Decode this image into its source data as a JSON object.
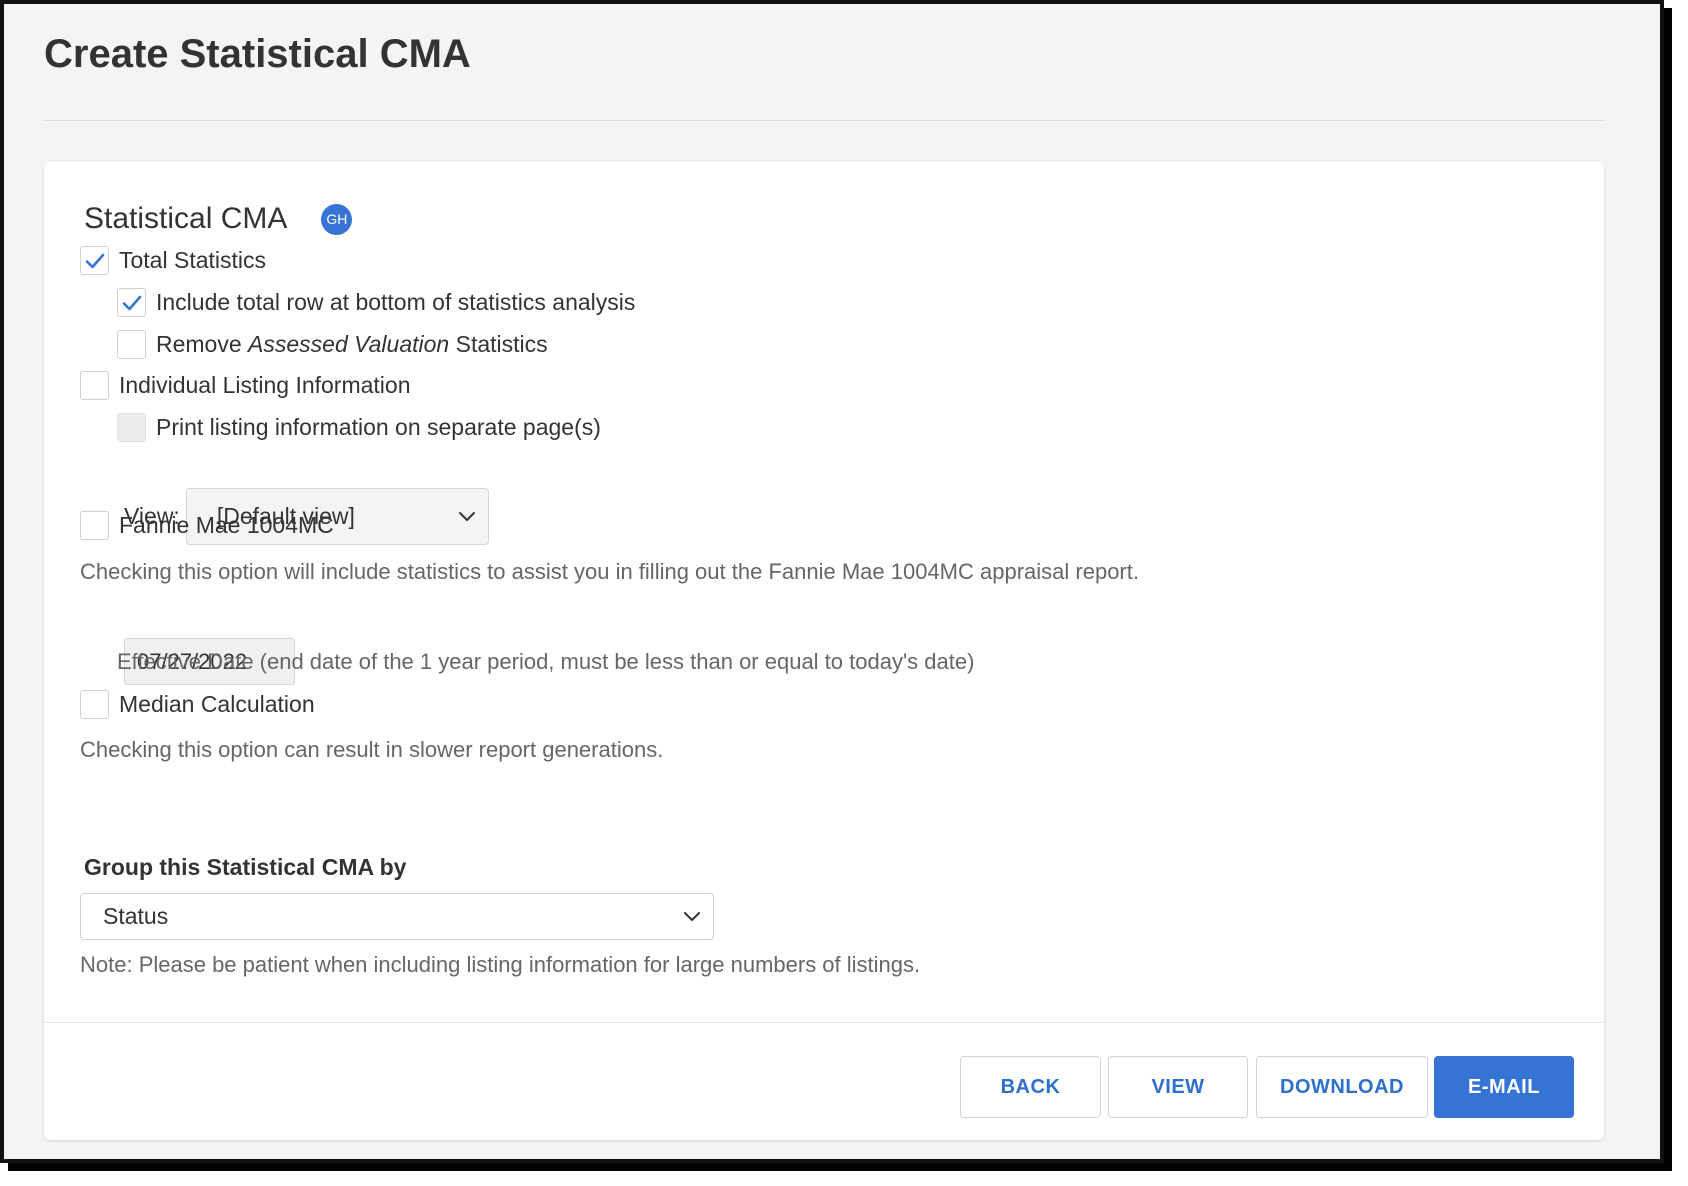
{
  "page": {
    "title": "Create Statistical CMA"
  },
  "card": {
    "title": "Statistical CMA",
    "avatar_initials": "GH"
  },
  "options": {
    "total_statistics": {
      "label": "Total Statistics",
      "checked": true
    },
    "include_total_row": {
      "label": "Include total row at bottom of statistics analysis",
      "checked": true
    },
    "remove_assessed": {
      "label_prefix": "Remove ",
      "label_italic": "Assessed Valuation",
      "label_suffix": " Statistics",
      "checked": false
    },
    "individual_listing": {
      "label": "Individual Listing Information",
      "checked": false
    },
    "print_separate": {
      "label": "Print listing information on separate page(s)",
      "checked": false,
      "disabled": true
    },
    "view": {
      "label": "View:",
      "selected": "[Default view]"
    },
    "fannie_mae": {
      "label": "Fannie Mae 1004MC",
      "checked": false,
      "help": "Checking this option will include statistics to assist you in filling out the Fannie Mae 1004MC appraisal report."
    },
    "effective_date": {
      "value": "07/27/2022",
      "help": "Effective Date (end date of the 1 year period, must be less than or equal to today's date)"
    },
    "median": {
      "label": "Median Calculation",
      "checked": false,
      "help": "Checking this option can result in slower report generations."
    }
  },
  "group_by": {
    "label": "Group this Statistical CMA by",
    "selected": "Status",
    "note": "Note: Please be patient when including listing information for large numbers of listings."
  },
  "buttons": {
    "back": "BACK",
    "view": "VIEW",
    "download": "DOWNLOAD",
    "email": "E-MAIL"
  },
  "colors": {
    "accent": "#3574d4",
    "link_text": "#2d6fcc",
    "page_bg": "#f4f4f4"
  }
}
